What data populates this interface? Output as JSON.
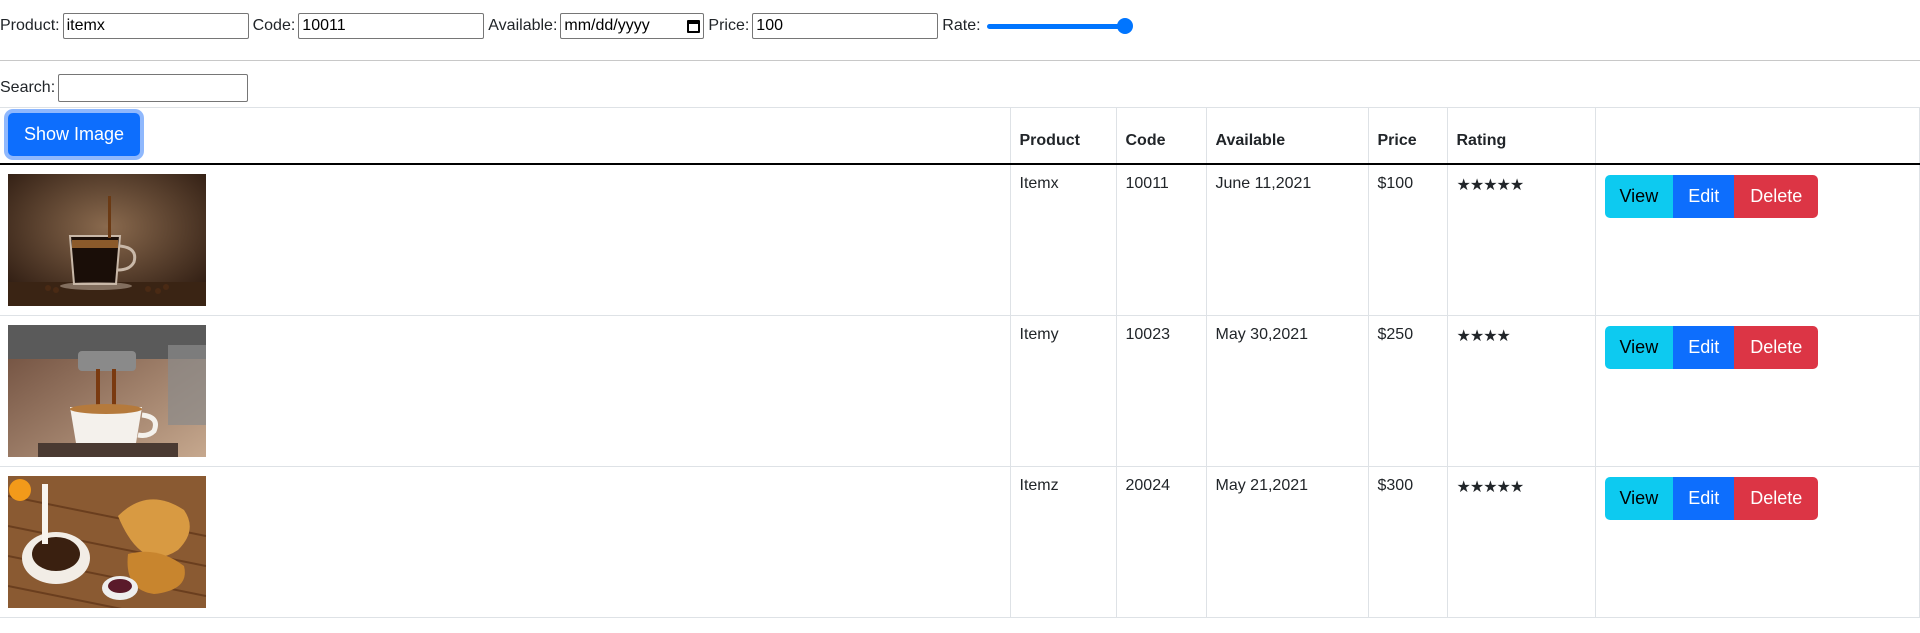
{
  "form": {
    "product_label": "Product:",
    "product_value": "itemx",
    "code_label": "Code:",
    "code_value": "10011",
    "available_label": "Available:",
    "available_placeholder": "mm/dd/yyyy",
    "price_label": "Price:",
    "price_value": "100",
    "rate_label": "Rate:",
    "rate_value": 1.0
  },
  "search": {
    "label": "Search:",
    "value": ""
  },
  "table": {
    "show_image_label": "Show Image",
    "headers": [
      "Product",
      "Code",
      "Available",
      "Price",
      "Rating",
      ""
    ],
    "rows": [
      {
        "product": "Itemx",
        "code": "10011",
        "available": "June 11,2021",
        "price": "$100",
        "rating": 5,
        "stars": "★★★★★",
        "image": "coffee-cup-with-beans"
      },
      {
        "product": "Itemy",
        "code": "10023",
        "available": "May 30,2021",
        "price": "$250",
        "rating": 4,
        "stars": "★★★★",
        "image": "espresso-machine-pouring"
      },
      {
        "product": "Itemz",
        "code": "20024",
        "available": "May 21,2021",
        "price": "$300",
        "rating": 5,
        "stars": "★★★★★",
        "image": "coffee-with-croissants"
      }
    ],
    "actions": {
      "view": "View",
      "edit": "Edit",
      "delete": "Delete"
    }
  },
  "colors": {
    "primary": "#0d6efd",
    "info": "#0dcaf0",
    "danger": "#dc3545",
    "slider": "#0075ff"
  }
}
